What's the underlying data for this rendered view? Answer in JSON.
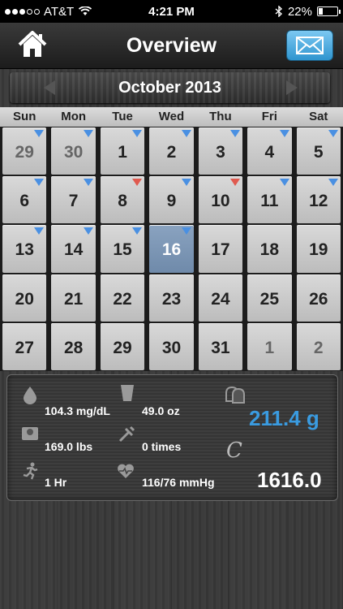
{
  "status_bar": {
    "carrier": "AT&T",
    "time": "4:21 PM",
    "battery": "22%",
    "battery_level": 0.22
  },
  "nav": {
    "title": "Overview"
  },
  "calendar": {
    "month": "October 2013",
    "weekdays": [
      "Sun",
      "Mon",
      "Tue",
      "Wed",
      "Thu",
      "Fri",
      "Sat"
    ],
    "days": [
      {
        "label": "29",
        "other": true,
        "marker": "blue"
      },
      {
        "label": "30",
        "other": true,
        "marker": "blue"
      },
      {
        "label": "1",
        "marker": "blue"
      },
      {
        "label": "2",
        "marker": "blue"
      },
      {
        "label": "3",
        "marker": "blue"
      },
      {
        "label": "4",
        "marker": "blue"
      },
      {
        "label": "5",
        "marker": "blue"
      },
      {
        "label": "6",
        "marker": "blue"
      },
      {
        "label": "7",
        "marker": "blue"
      },
      {
        "label": "8",
        "marker": "red"
      },
      {
        "label": "9",
        "marker": "blue"
      },
      {
        "label": "10",
        "marker": "red"
      },
      {
        "label": "11",
        "marker": "blue"
      },
      {
        "label": "12",
        "marker": "blue"
      },
      {
        "label": "13",
        "marker": "blue"
      },
      {
        "label": "14",
        "marker": "blue"
      },
      {
        "label": "15",
        "marker": "blue"
      },
      {
        "label": "16",
        "marker": "blue",
        "selected": true
      },
      {
        "label": "17"
      },
      {
        "label": "18"
      },
      {
        "label": "19"
      },
      {
        "label": "20"
      },
      {
        "label": "21"
      },
      {
        "label": "22"
      },
      {
        "label": "23"
      },
      {
        "label": "24"
      },
      {
        "label": "25"
      },
      {
        "label": "26"
      },
      {
        "label": "27"
      },
      {
        "label": "28"
      },
      {
        "label": "29"
      },
      {
        "label": "30"
      },
      {
        "label": "31"
      },
      {
        "label": "1",
        "other": true
      },
      {
        "label": "2",
        "other": true
      }
    ]
  },
  "summary": {
    "glucose": "104.3 mg/dL",
    "water": "49.0 oz",
    "carbs": "211.4 g",
    "weight": "169.0 lbs",
    "medication": "0 times",
    "exercise": "1 Hr",
    "blood_pressure": "116/76 mmHg",
    "calories_symbol": "C",
    "calories": "1616.0"
  },
  "colors": {
    "accent_blue": "#3a9be0",
    "marker_blue": "#4a90e2",
    "marker_red": "#e05a4f",
    "selected_day": "#7d97b6"
  }
}
